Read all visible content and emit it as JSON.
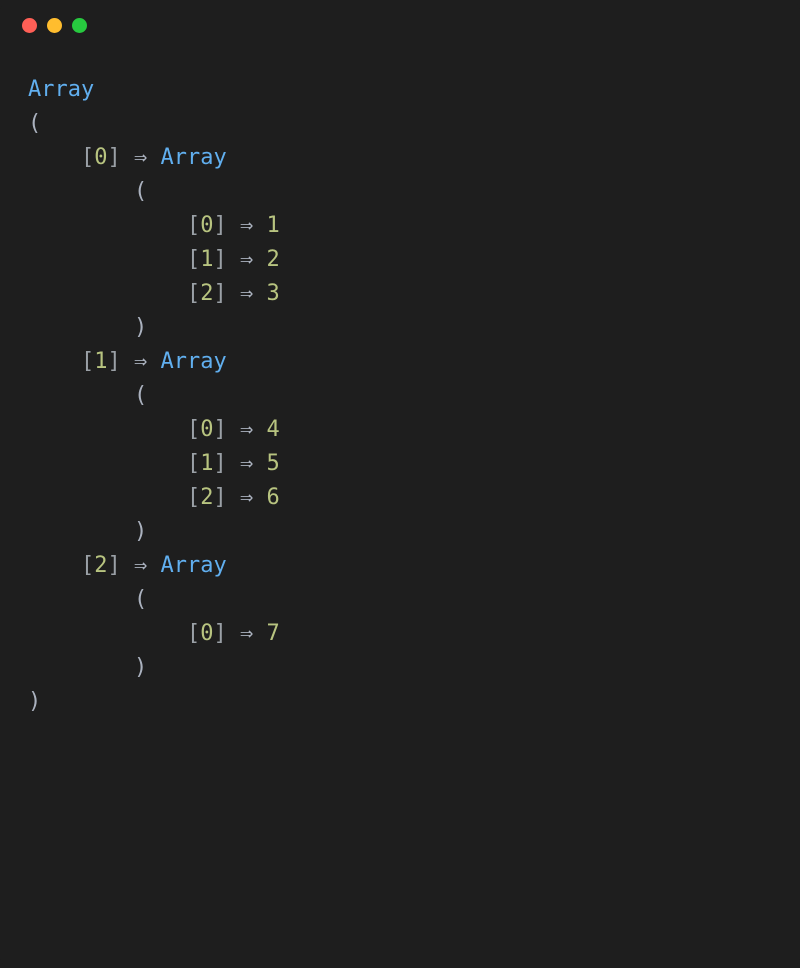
{
  "keywords": {
    "array": "Array"
  },
  "symbols": {
    "open_paren": "(",
    "close_paren": ")",
    "arrow": "⇒",
    "lbracket": "[",
    "rbracket": "]"
  },
  "outer": {
    "indices": [
      "0",
      "1",
      "2"
    ]
  },
  "inner": [
    {
      "idx": "0",
      "items": [
        {
          "k": "0",
          "v": "1"
        },
        {
          "k": "1",
          "v": "2"
        },
        {
          "k": "2",
          "v": "3"
        }
      ]
    },
    {
      "idx": "1",
      "items": [
        {
          "k": "0",
          "v": "4"
        },
        {
          "k": "1",
          "v": "5"
        },
        {
          "k": "2",
          "v": "6"
        }
      ]
    },
    {
      "idx": "2",
      "items": [
        {
          "k": "0",
          "v": "7"
        }
      ]
    }
  ]
}
